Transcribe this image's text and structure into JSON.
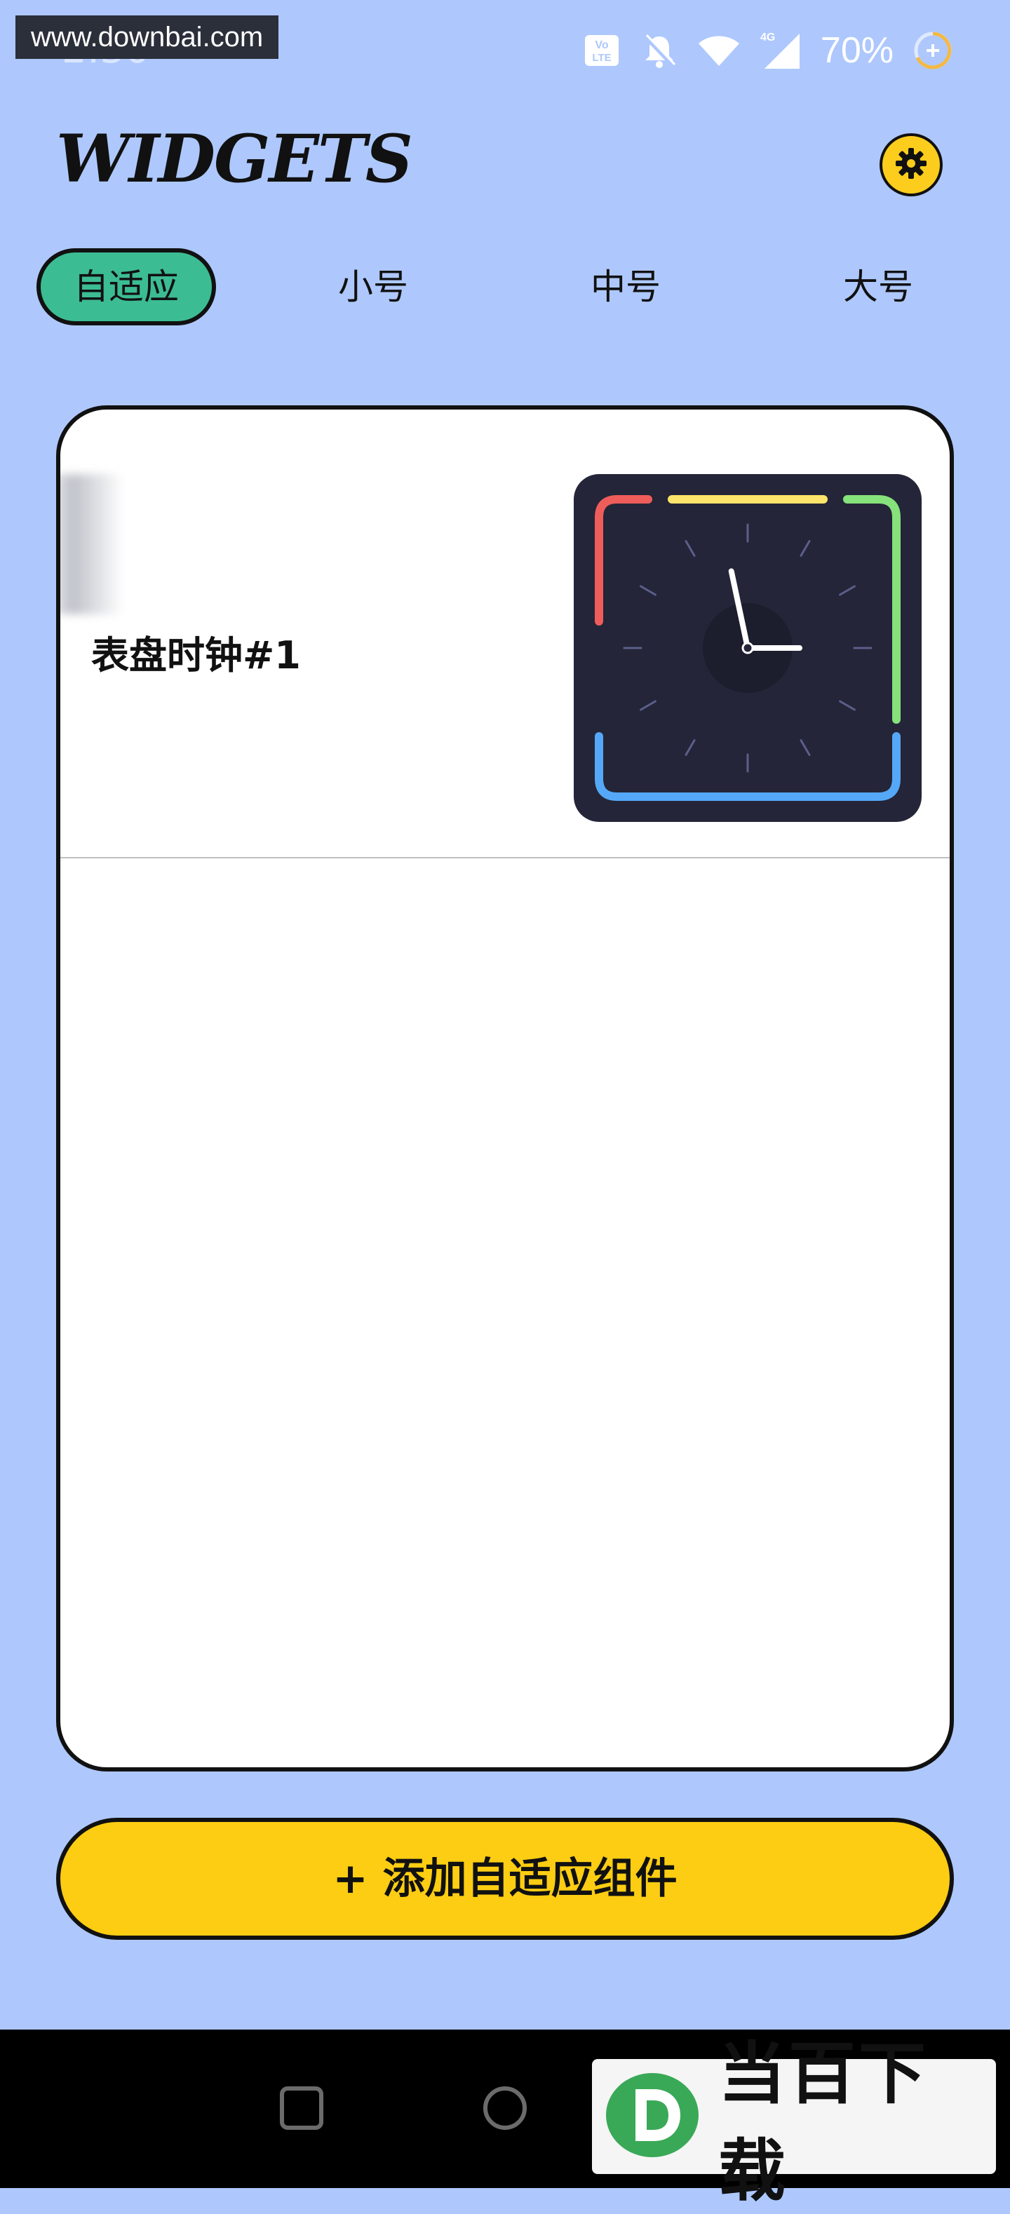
{
  "status_bar": {
    "time": "2:30",
    "watermark": "www.downbai.com",
    "battery": "70%",
    "icons": [
      "volte-icon",
      "bell-off-icon",
      "wifi-icon",
      "signal-4g-icon",
      "battery-saver-icon"
    ]
  },
  "header": {
    "title": "WIDGETS",
    "settings_icon": "gear-icon"
  },
  "tabs": [
    {
      "label": "自适应",
      "active": true
    },
    {
      "label": "小号",
      "active": false
    },
    {
      "label": "中号",
      "active": false
    },
    {
      "label": "大号",
      "active": false
    }
  ],
  "widgets": [
    {
      "name": "表盘时钟#1",
      "preview": "analog-clock",
      "clock": {
        "hour": 11.6,
        "minute": 15
      }
    }
  ],
  "add_button": {
    "label": "+ 添加自适应组件"
  },
  "colors": {
    "background": "#aec8fd",
    "active_tab": "#3cbc93",
    "accent_yellow": "#fccd12",
    "clock_face": "#242538",
    "clock_red": "#ef5d5a",
    "clock_yellow": "#fde46a",
    "clock_green": "#86e27a",
    "clock_blue": "#55a8f7"
  },
  "nav_bar": {
    "icons": [
      "recent-apps-icon",
      "home-icon"
    ]
  },
  "overlay_logo": {
    "text": "当百下载"
  }
}
